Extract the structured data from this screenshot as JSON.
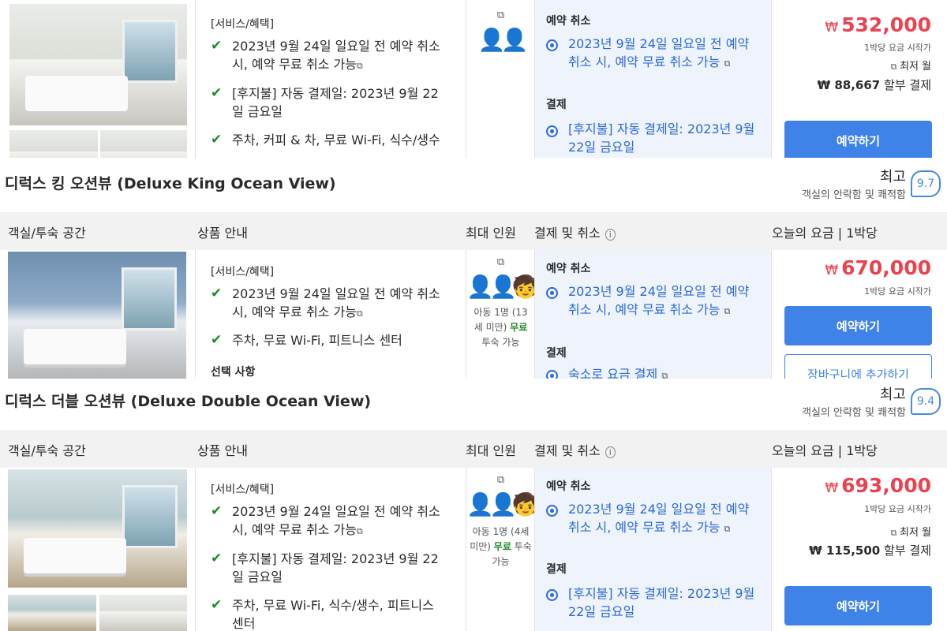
{
  "rooms": [
    {
      "title": "",
      "benefits_title": "[서비스/혜택]",
      "benefits": [
        {
          "text": "2023년 9월 24일 일요일 전 예약 취소 시, 예약 무료 취소 가능",
          "icon": "external-link-icon"
        },
        {
          "text": "[후지불] 자동 결제일: 2023년 9월 22일 금요일"
        },
        {
          "text": "주차, 커피 & 차, 무료 Wi-Fi, 식수/생수"
        }
      ],
      "cancel_title": "예약 취소",
      "cancel_text": "2023년 9월 24일 일요일 전 예약 취소 시, 예약 무료 취소 가능",
      "pay_title": "결제",
      "pay_text": "[후지불] 자동 결제일: 2023년 9월 22일 금요일",
      "price_currency": "₩",
      "price": "532,000",
      "price_sub": "1박당 요금 시작가",
      "monthly_label": "최저 월",
      "install_amount": "₩ 88,667",
      "install_label": "할부 결제",
      "book_label": "예약하기"
    },
    {
      "title": "디럭스 킹 오션뷰 (Deluxe King Ocean View)",
      "rating_word": "최고",
      "rating_sub": "객실의 안락함 및 쾌적함",
      "rating_score": "9.7",
      "benefits_title": "[서비스/혜택]",
      "benefits": [
        {
          "text": "2023년 9월 24일 일요일 전 예약 취소 시, 예약 무료 취소 가능"
        },
        {
          "text": "주차, 무료 Wi-Fi, 피트니스 센터"
        }
      ],
      "options_title": "선택 사항",
      "occ_child": "아동 1명 (13세 미만)",
      "occ_free": "무료",
      "occ_stay": "투숙 가능",
      "cancel_title": "예약 취소",
      "cancel_text": "2023년 9월 24일 일요일 전 예약 취소 시, 예약 무료 취소 가능",
      "pay_title": "결제",
      "pay_text": "숙소로 요금 결제",
      "price_currency": "₩",
      "price": "670,000",
      "price_sub": "1박당 요금 시작가",
      "book_label": "예약하기",
      "cart_label": "장바구니에 추가하기"
    },
    {
      "title": "디럭스 더블 오션뷰 (Deluxe Double Ocean View)",
      "rating_word": "최고",
      "rating_sub": "객실의 안락함 및 쾌적함",
      "rating_score": "9.4",
      "benefits_title": "[서비스/혜택]",
      "benefits": [
        {
          "text": "2023년 9월 24일 일요일 전 예약 취소 시, 예약 무료 취소 가능"
        },
        {
          "text": "[후지불] 자동 결제일: 2023년 9월 22일 금요일"
        },
        {
          "text": "주차, 무료 Wi-Fi, 식수/생수, 피트니스 센터"
        }
      ],
      "occ_child": "아동 1명 (4세 미만)",
      "occ_free": "무료",
      "occ_stay": "투숙 가능",
      "cancel_title": "예약 취소",
      "cancel_text": "2023년 9월 24일 일요일 전 예약 취소 시, 예약 무료 취소 가능",
      "pay_title": "결제",
      "pay_text": "[후지불] 자동 결제일: 2023년 9월 22일 금요일",
      "price_currency": "₩",
      "price": "693,000",
      "price_sub": "1박당 요금 시작가",
      "monthly_label": "최저 월",
      "install_amount": "₩ 115,500",
      "install_label": "할부 결제",
      "book_label": "예약하기"
    }
  ],
  "header": {
    "room": "객실/투숙 공간",
    "product": "상품 안내",
    "max_guests": "최대 인원",
    "payment_cancel": "결제 및 취소",
    "today_price": "오늘의 요금 | 1박당"
  },
  "colors": {
    "accent": "#3f82e8",
    "price": "#e8434f",
    "check": "#1f8b24",
    "pay_bg": "#eef3fc"
  }
}
